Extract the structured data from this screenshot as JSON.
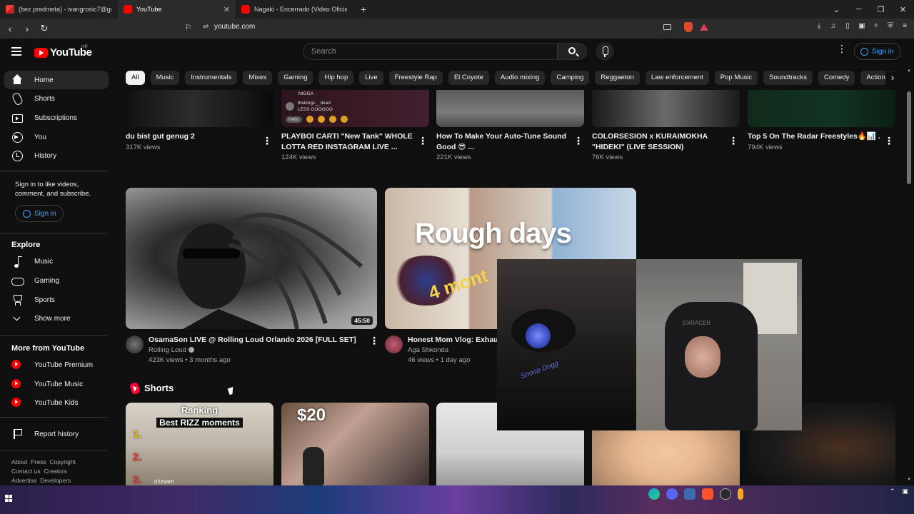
{
  "browser": {
    "tabs": [
      {
        "label": "(bez predmeta) - ivangrosic7@gmail",
        "icon": "gmail-icon",
        "active": false
      },
      {
        "label": "YouTube",
        "icon": "youtube-icon",
        "active": true
      },
      {
        "label": "Nagaki - Encerrado (Video Oficial) - Y",
        "icon": "youtube-icon",
        "active": false
      }
    ],
    "new_tab": "+",
    "url": "youtube.com"
  },
  "header": {
    "logo_text": "YouTube",
    "region": "HR",
    "search_placeholder": "Search",
    "signin_label": "Sign in"
  },
  "chips": [
    "All",
    "Music",
    "Instrumentals",
    "Mixes",
    "Gaming",
    "Hip hop",
    "Live",
    "Freestyle Rap",
    "El Coyote",
    "Audio mixing",
    "Camping",
    "Reggaeton",
    "Law enforcement",
    "Pop Music",
    "Soundtracks",
    "Comedy",
    "Action-a"
  ],
  "sidebar": {
    "main": [
      {
        "label": "Home",
        "icon": "home-icon"
      },
      {
        "label": "Shorts",
        "icon": "shorts-icon"
      },
      {
        "label": "Subscriptions",
        "icon": "subscriptions-icon"
      },
      {
        "label": "You",
        "icon": "you-icon"
      },
      {
        "label": "History",
        "icon": "history-icon"
      }
    ],
    "signin_prompt": "Sign in to like videos, comment, and subscribe.",
    "signin_label": "Sign in",
    "explore_title": "Explore",
    "explore": [
      {
        "label": "Music",
        "icon": "music-icon"
      },
      {
        "label": "Gaming",
        "icon": "gaming-icon"
      },
      {
        "label": "Sports",
        "icon": "sports-icon"
      },
      {
        "label": "Show more",
        "icon": "chevron-down-icon"
      }
    ],
    "more_title": "More from YouTube",
    "more": [
      {
        "label": "YouTube Premium",
        "icon": "youtube-premium-icon"
      },
      {
        "label": "YouTube Music",
        "icon": "youtube-music-icon"
      },
      {
        "label": "YouTube Kids",
        "icon": "youtube-kids-icon"
      }
    ],
    "report": {
      "label": "Report history",
      "icon": "flag-icon"
    },
    "footer": [
      "About",
      "Press",
      "Copyright",
      "Contact us",
      "Creators",
      "Advertise",
      "Developers"
    ]
  },
  "top_row": [
    {
      "title": "du bist gut genug 2",
      "title2": "",
      "views": "317K views"
    },
    {
      "title": "PLAYBOI CARTI \"New Tank\" WHOLE",
      "title2": "LOTTA RED INSTAGRAM LIVE ...",
      "views": "124K views",
      "chat": [
        "NIGGA",
        "thekings__dead",
        "LESS GOOOOO",
        "Hello"
      ]
    },
    {
      "title": "How To Make Your Auto-Tune Sound",
      "title2": "Good 😎 ...",
      "views": "221K views"
    },
    {
      "title": "COLORSESION x KURAIMOKHA",
      "title2": "\"HIDEKI\" (LIVE SESSION)",
      "views": "76K views"
    },
    {
      "title": "Top 5 On The Radar Freestyles🔥📊 ...",
      "title2": "",
      "views": "794K views"
    }
  ],
  "featured": [
    {
      "title": "OsamaSon LIVE @ Rolling Loud Orlando 2026 [FULL SET]",
      "channel": "Rolling Loud",
      "meta": "423K views • 3 months ago",
      "duration": "45:50"
    },
    {
      "title": "Honest Mom Vlog: Exhaus",
      "channel": "Aga Shkonda",
      "meta": "46 views • 1 day ago",
      "thumb_text": "Rough days",
      "thumb_text2": "4 mont"
    }
  ],
  "shorts": {
    "title": "Shorts",
    "items": [
      {
        "line1": "Ranking",
        "line2": "Best RIZZ moments",
        "n1": "1.",
        "n2": "2.",
        "n3": "3.",
        "handle": "rizzsam"
      },
      {
        "text": "$20"
      },
      {},
      {},
      {}
    ]
  },
  "overlay": {
    "headphone_text": "Snoop Dogg",
    "chair_text": "DXRACER"
  },
  "colors": {
    "bg": "#0f0f0f",
    "accent": "#3ea6ff",
    "brand": "#ff0000"
  }
}
